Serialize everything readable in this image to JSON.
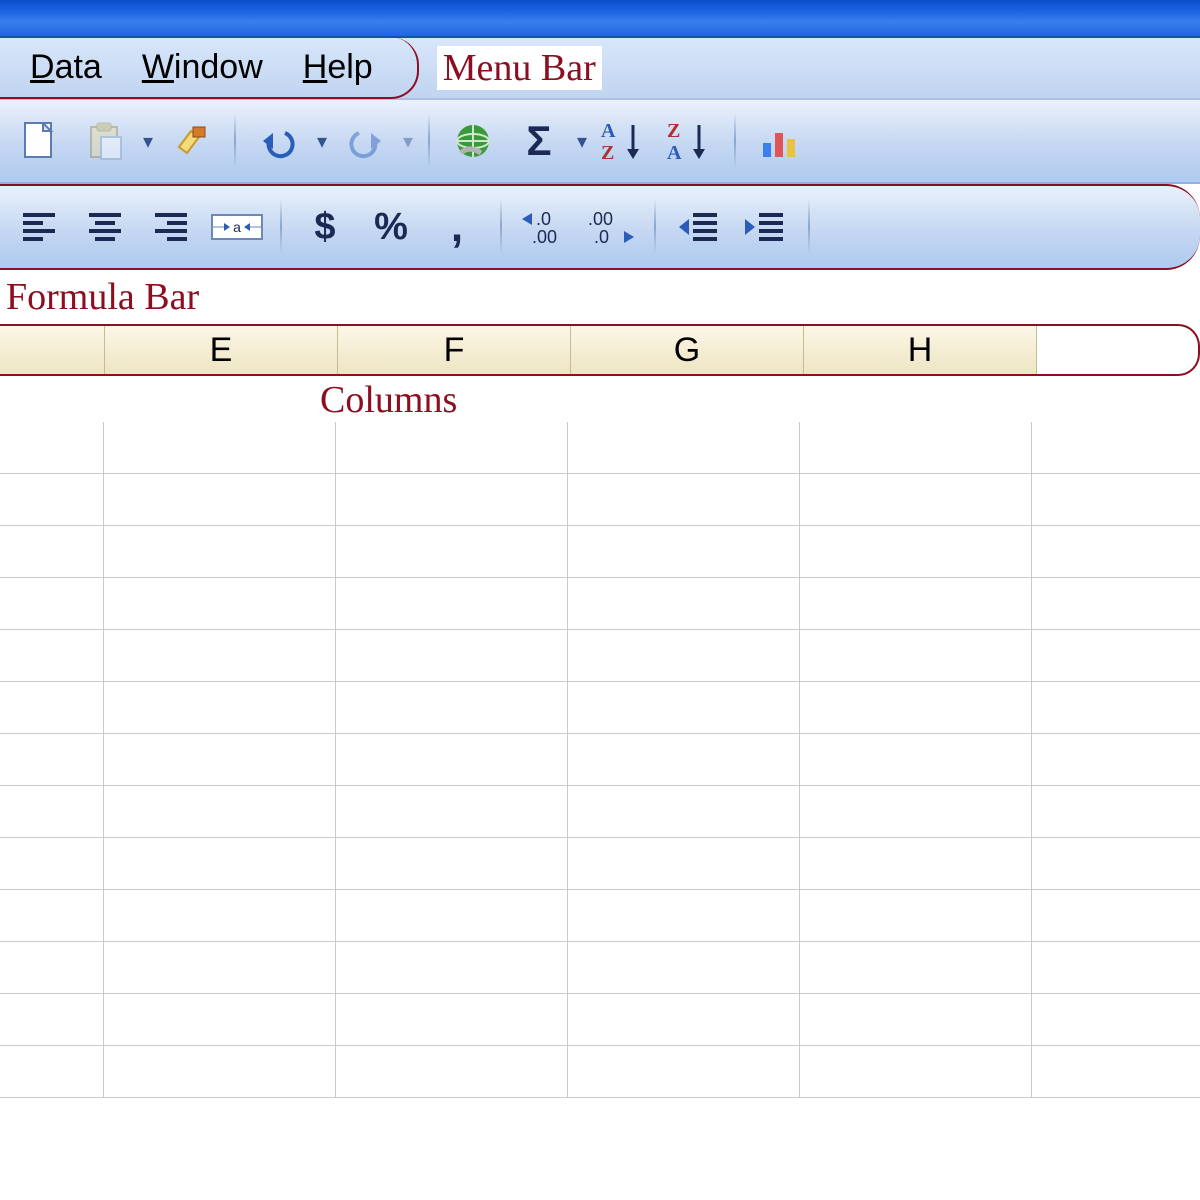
{
  "menubar": {
    "items": [
      {
        "label": "Data",
        "mn": "D",
        "rest": "ata"
      },
      {
        "label": "Window",
        "mn": "W",
        "rest": "indow"
      },
      {
        "label": "Help",
        "mn": "H",
        "rest": "elp"
      }
    ],
    "annotation": "Menu Bar"
  },
  "toolbar1": {
    "icons": [
      "new-doc",
      "paste",
      "dropdown",
      "format-painter",
      "sep",
      "undo",
      "dropdown",
      "redo",
      "dropdown",
      "sep",
      "hyperlink",
      "sum",
      "dropdown",
      "sort-asc",
      "sort-desc",
      "sep",
      "wizard"
    ]
  },
  "toolbar2": {
    "icons": [
      "align-left",
      "align-center",
      "align-right",
      "merge-center",
      "sep",
      "currency",
      "percent",
      "comma",
      "sep",
      "increase-decimal",
      "decrease-decimal",
      "sep",
      "decrease-indent",
      "increase-indent",
      "sep"
    ],
    "currency_label": "$",
    "percent_label": "%",
    "comma_label": ","
  },
  "formula_bar_annotation": "Formula Bar",
  "columns": {
    "headers": [
      "",
      "E",
      "F",
      "G",
      "H"
    ],
    "annotation": "Columns"
  },
  "grid": {
    "rows": 13,
    "cols": 6
  }
}
